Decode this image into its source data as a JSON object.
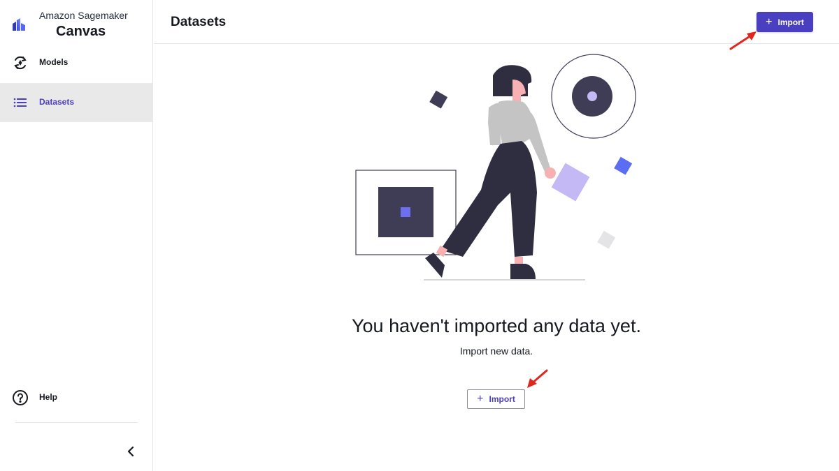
{
  "brand": {
    "subtitle": "Amazon Sagemaker",
    "title": "Canvas",
    "logo_icon": "canvas-logo-icon"
  },
  "sidebar": {
    "items": [
      {
        "label": "Models",
        "icon": "models-refresh-icon",
        "active": false
      },
      {
        "label": "Datasets",
        "icon": "list-icon",
        "active": true
      }
    ],
    "help": {
      "label": "Help",
      "icon": "help-circle-icon"
    },
    "collapse_icon": "chevron-left-icon"
  },
  "header": {
    "title": "Datasets",
    "import_button": {
      "label": "Import",
      "icon": "plus-icon"
    }
  },
  "empty_state": {
    "title": "You haven't imported any data yet.",
    "subtitle": "Import new data.",
    "import_button": {
      "label": "Import",
      "icon": "plus-icon"
    }
  },
  "colors": {
    "accent": "#4a3fc0",
    "active_nav_bg": "#e9e9ea",
    "annotation_arrow": "#e0271f",
    "illustration_dark": "#3f3d56",
    "illustration_light_purple": "#c4b8f5"
  }
}
